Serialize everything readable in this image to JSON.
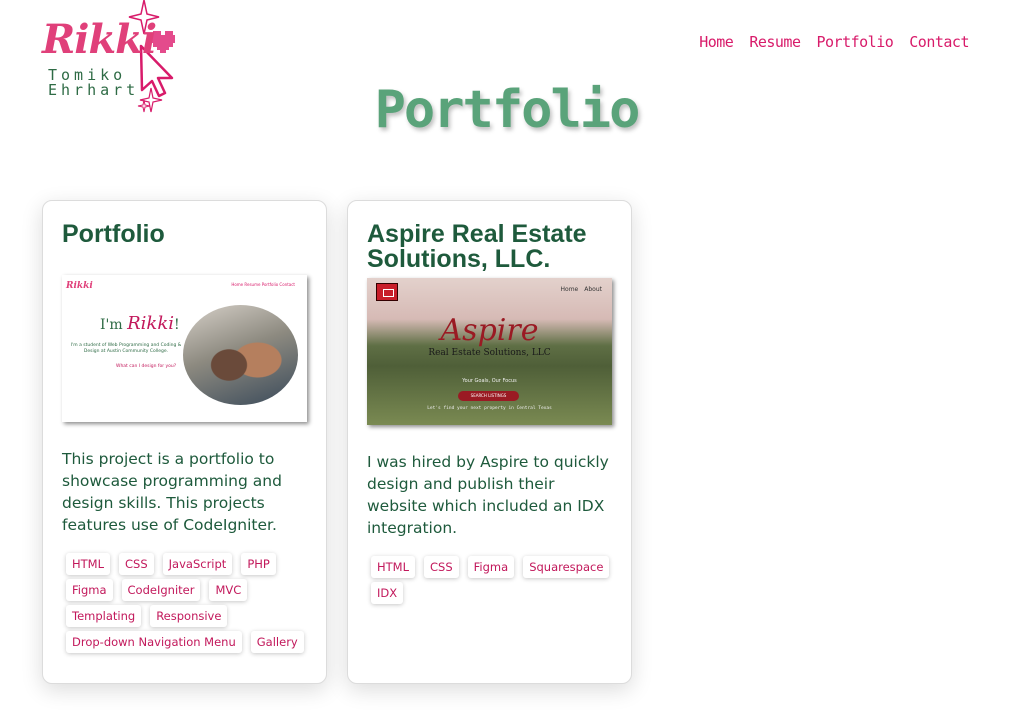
{
  "logo": {
    "script_name": "Rikki",
    "name_line1": "Tomiko",
    "name_line2": "Ehrhart"
  },
  "nav": {
    "items": [
      "Home",
      "Resume",
      "Portfolio",
      "Contact"
    ]
  },
  "page_title": "Portfolio",
  "colors": {
    "accent_pink": "#d81b6a",
    "title_green": "#5aa37a",
    "heading_green": "#1e5a3c"
  },
  "projects": [
    {
      "title": "Portfolio",
      "description": "This project is a portfolio to showcase programming and design skills. This projects features use of CodeIgniter.",
      "tags": [
        "HTML",
        "CSS",
        "JavaScript",
        "PHP",
        "Figma",
        "CodeIgniter",
        "MVC",
        "Templating",
        "Responsive",
        "Drop-down Navigation Menu",
        "Gallery"
      ],
      "thumbnail": {
        "logo": "Rikki",
        "nav": "Home  Resume  Portfolio  Contact",
        "greeting": "I'm",
        "name": "Rikki",
        "exclaim": "!",
        "subtext": "I'm a student of Web Programming and Coding & Design at Austin Community College.",
        "cta": "What can I design for you?"
      }
    },
    {
      "title": "Aspire Real Estate Solutions, LLC.",
      "description": "I was hired by Aspire to quickly design and publish their website which included an IDX integration.",
      "tags": [
        "HTML",
        "CSS",
        "Figma",
        "Squarespace",
        "IDX"
      ],
      "thumbnail": {
        "nav": [
          "Home",
          "About"
        ],
        "brand": "Aspire",
        "subtitle": "Real Estate Solutions, LLC",
        "tagline": "Your Goals, Our Focus",
        "button": "SEARCH LISTINGS",
        "footer": "Let's find your next property in Central Texas"
      }
    }
  ]
}
